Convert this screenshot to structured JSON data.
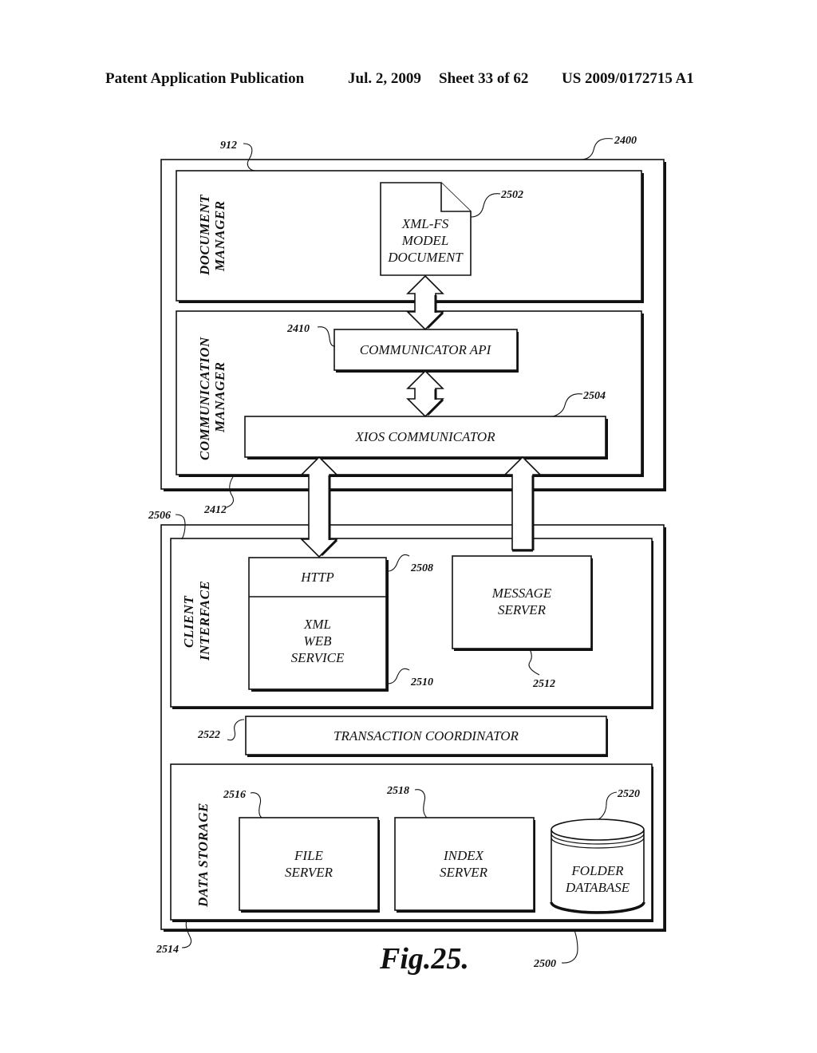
{
  "header": {
    "publication": "Patent Application Publication",
    "date": "Jul. 2, 2009",
    "sheet": "Sheet 33 of 62",
    "number": "US 2009/0172715 A1"
  },
  "figure": {
    "caption": "Fig.25.",
    "system_top": {
      "ref": "2400",
      "document_manager": {
        "ref": "912",
        "label_line1": "DOCUMENT",
        "label_line2": "MANAGER",
        "model_document": {
          "ref": "2502",
          "lines": [
            "XML-FS",
            "MODEL",
            "DOCUMENT"
          ]
        }
      },
      "communication_manager": {
        "ref": "2412",
        "label_line1": "COMMUNICATION",
        "label_line2": "MANAGER",
        "communicator_api": {
          "ref": "2410",
          "label": "COMMUNICATOR API"
        },
        "xios_communicator": {
          "ref": "2504",
          "label": "XIOS COMMUNICATOR"
        }
      }
    },
    "system_bottom": {
      "ref": "2500",
      "client_interface": {
        "ref": "2506",
        "label_line1": "CLIENT",
        "label_line2": "INTERFACE",
        "http": {
          "ref": "2508",
          "label": "HTTP"
        },
        "xml_web_service": {
          "ref": "2510",
          "lines": [
            "XML",
            "WEB",
            "SERVICE"
          ]
        },
        "message_server": {
          "ref": "2512",
          "lines": [
            "MESSAGE",
            "SERVER"
          ]
        }
      },
      "transaction_coordinator": {
        "ref": "2522",
        "label": "TRANSACTION COORDINATOR"
      },
      "data_storage": {
        "ref": "2514",
        "label": "DATA STORAGE",
        "file_server": {
          "ref": "2516",
          "lines": [
            "FILE",
            "SERVER"
          ]
        },
        "index_server": {
          "ref": "2518",
          "lines": [
            "INDEX",
            "SERVER"
          ]
        },
        "folder_database": {
          "ref": "2520",
          "lines": [
            "FOLDER",
            "DATABASE"
          ]
        }
      }
    }
  }
}
